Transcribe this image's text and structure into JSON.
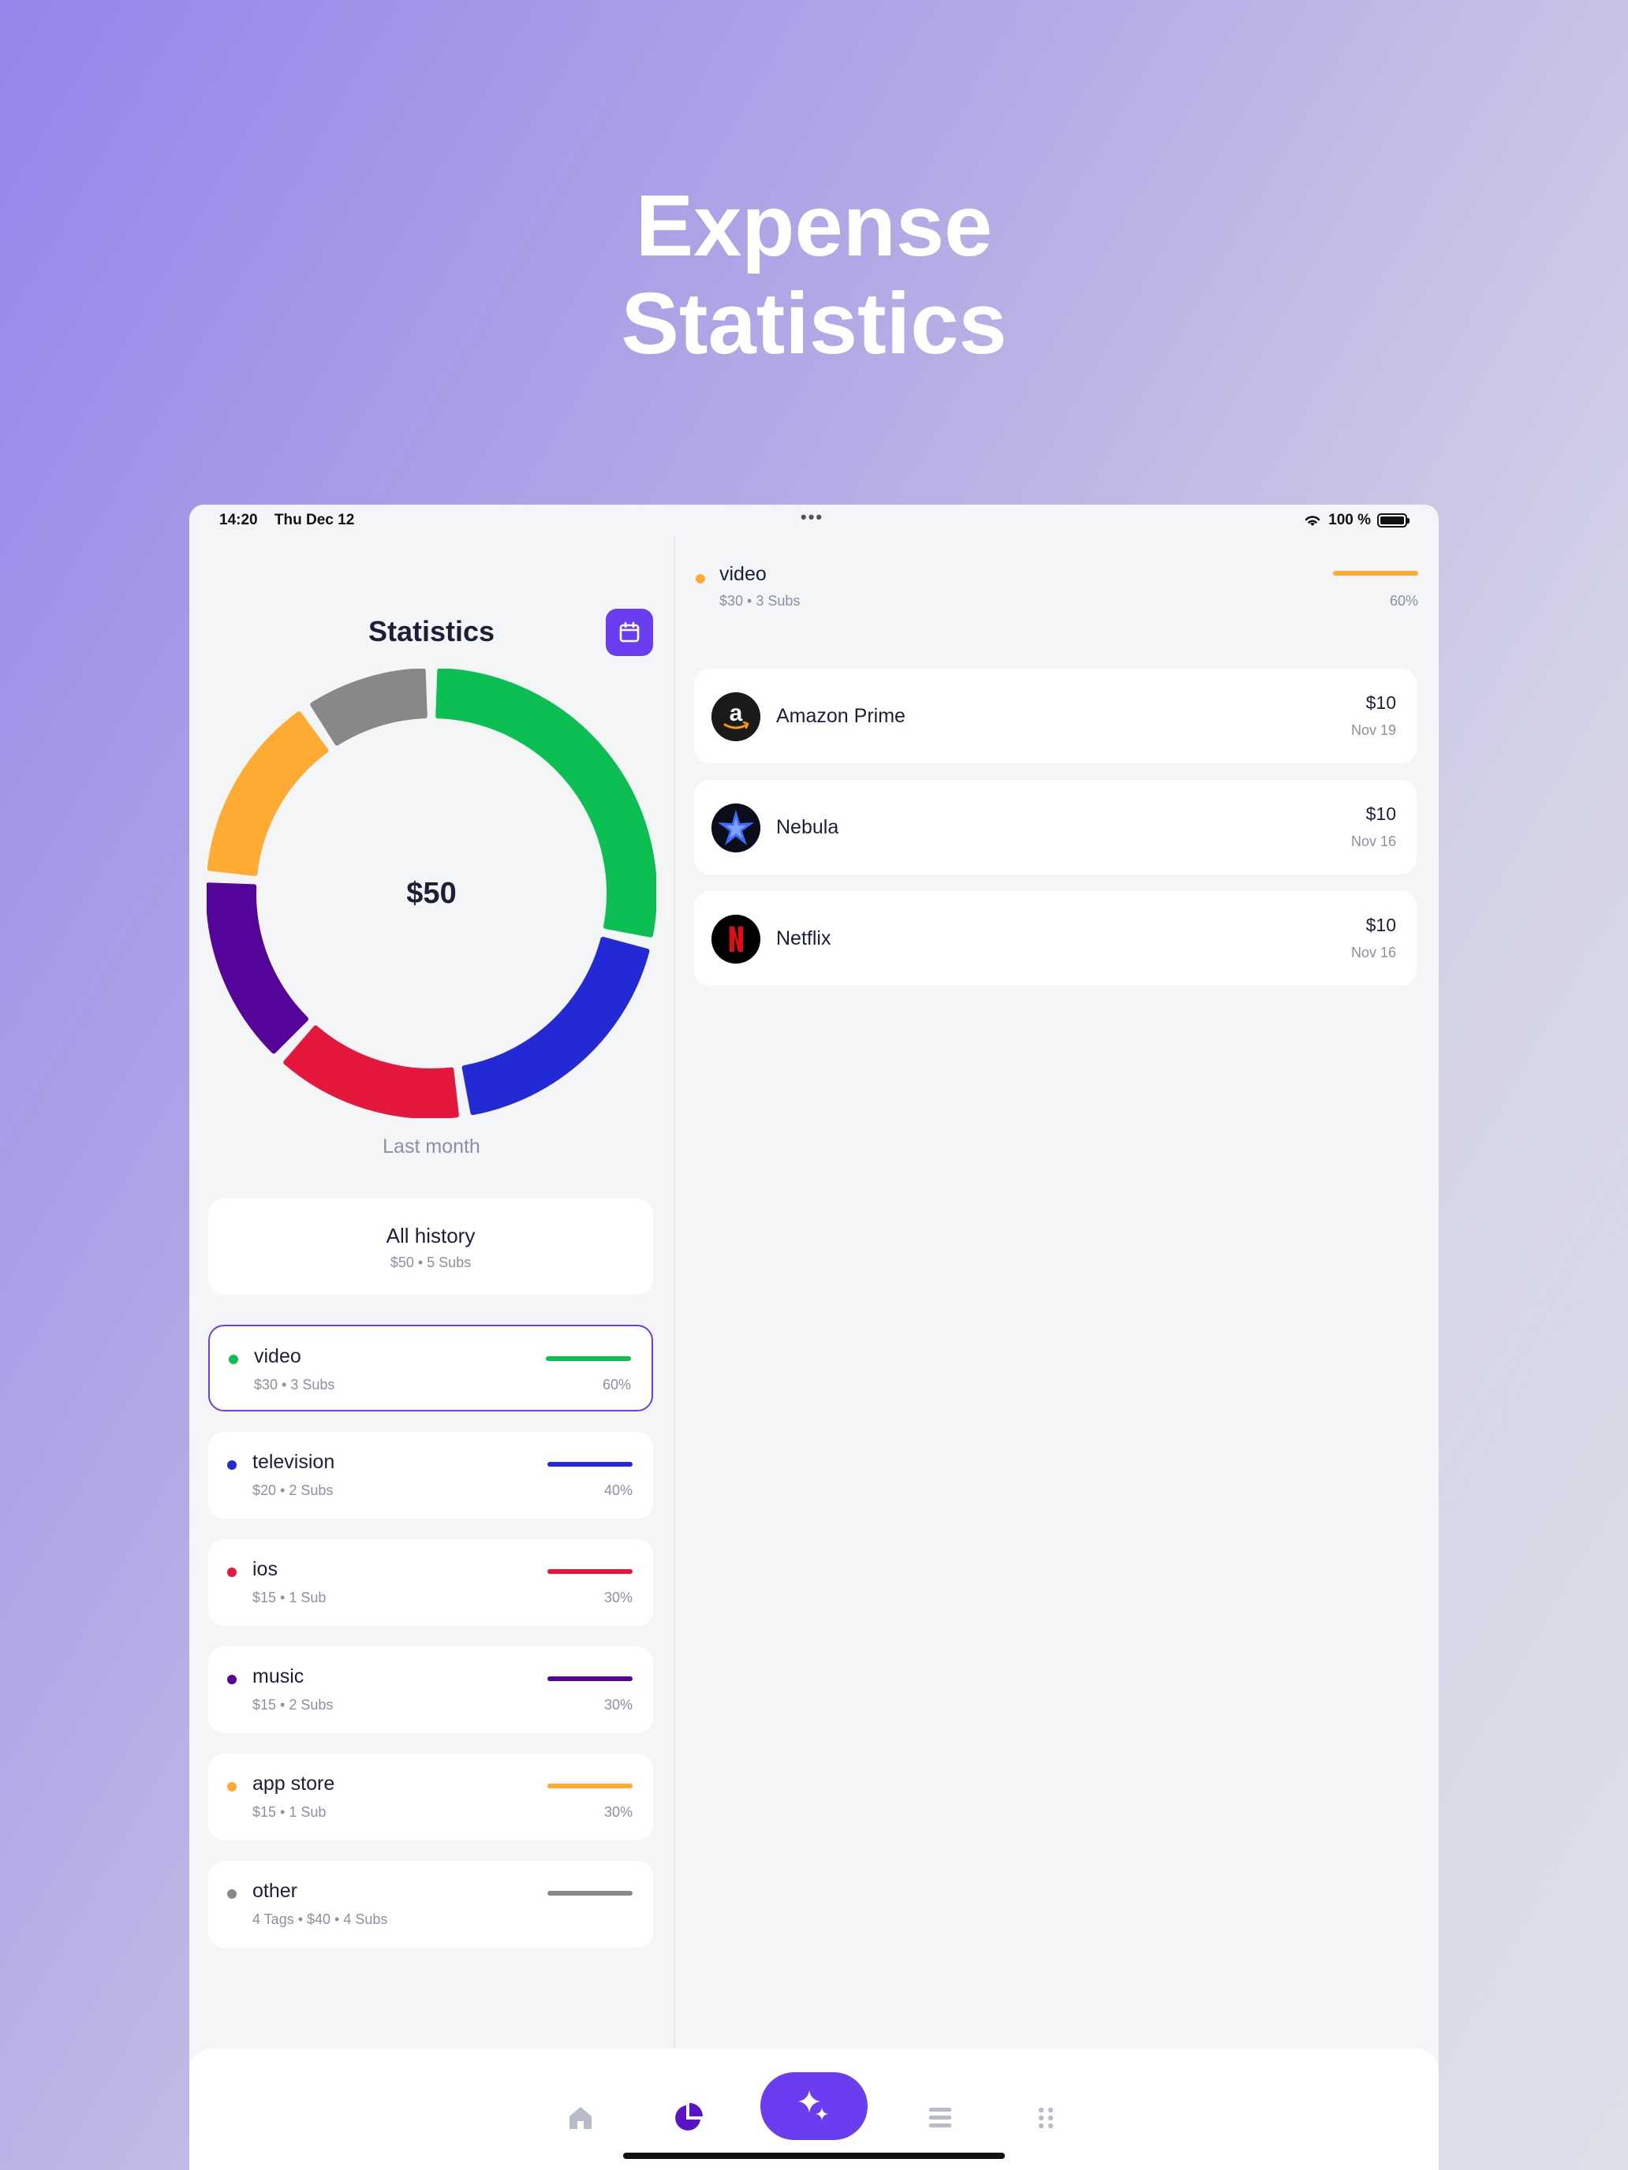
{
  "hero": {
    "line1": "Expense",
    "line2": "Statistics"
  },
  "status": {
    "time": "14:20",
    "date": "Thu Dec 12",
    "dots": "•••",
    "battery": "100 %"
  },
  "left": {
    "title": "Statistics",
    "total": "$50",
    "period": "Last month",
    "all_history": {
      "title": "All history",
      "sub": "$50 • 5 Subs"
    },
    "categories": [
      {
        "name": "video",
        "sub": "$30 • 3 Subs",
        "pct": "60%",
        "color": "#0bbf52"
      },
      {
        "name": "television",
        "sub": "$20 • 2 Subs",
        "pct": "40%",
        "color": "#2429d6"
      },
      {
        "name": "ios",
        "sub": "$15 • 1 Sub",
        "pct": "30%",
        "color": "#e5173c"
      },
      {
        "name": "music",
        "sub": "$15 • 2 Subs",
        "pct": "30%",
        "color": "#55059a"
      },
      {
        "name": "app store",
        "sub": "$15 • 1 Sub",
        "pct": "30%",
        "color": "#ffaa33"
      },
      {
        "name": "other",
        "sub": "4 Tags • $40 • 4 Subs",
        "pct": "",
        "color": "#888888"
      }
    ]
  },
  "chart_data": {
    "type": "pie",
    "categories": [
      "video",
      "television",
      "ios",
      "music",
      "app store",
      "other"
    ],
    "colors": [
      "#0bbf52",
      "#2429d6",
      "#e5173c",
      "#55059a",
      "#ffaa33",
      "#888888"
    ],
    "values": [
      30,
      20,
      15,
      15,
      15,
      10
    ]
  },
  "right": {
    "header": {
      "name": "video",
      "sub": "$30 • 3 Subs",
      "pct": "60%",
      "color": "#ffaa33"
    },
    "subs": [
      {
        "name": "Amazon Prime",
        "amount": "$10",
        "date": "Nov 19",
        "icon": "amazon-logo"
      },
      {
        "name": "Nebula",
        "amount": "$10",
        "date": "Nov 16",
        "icon": "nebula-logo"
      },
      {
        "name": "Netflix",
        "amount": "$10",
        "date": "Nov 16",
        "icon": "netflix-logo"
      }
    ]
  },
  "tabs": [
    {
      "icon": "home-icon"
    },
    {
      "icon": "pie-chart-icon"
    },
    {
      "icon": "sparkles-icon"
    },
    {
      "icon": "list-icon"
    },
    {
      "icon": "grid-icon"
    }
  ],
  "colors": {
    "accent": "#6a3ef0"
  }
}
